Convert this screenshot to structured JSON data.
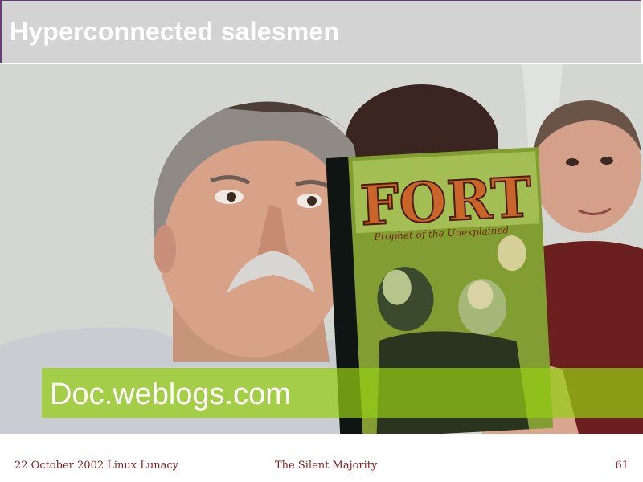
{
  "slide": {
    "title": "Hyperconnected salesmen",
    "caption": "Doc.weblogs.com",
    "comic_title": "FORT",
    "comic_subtitle": "Prophet of the Unexplained"
  },
  "footer": {
    "left": "22 October 2002 Linux Lunacy",
    "center": "The Silent Majority",
    "page_number": "61"
  }
}
